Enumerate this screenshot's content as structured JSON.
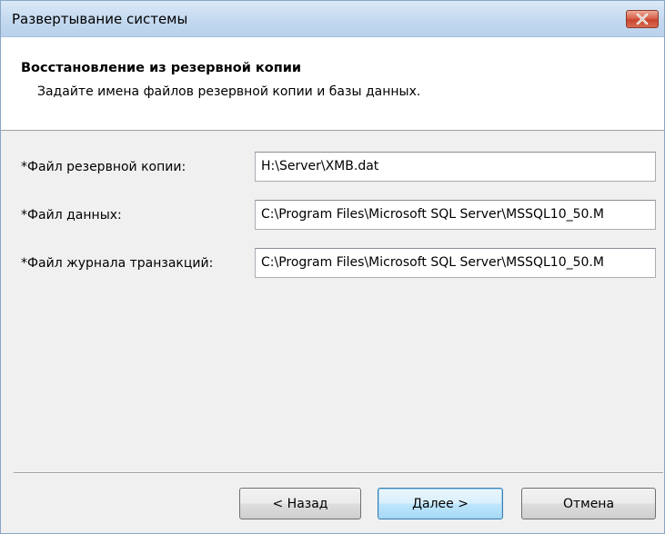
{
  "window": {
    "title": "Развертывание системы"
  },
  "header": {
    "title": "Восстановление из резервной копии",
    "subtitle": "Задайте имена файлов резервной копии и базы данных."
  },
  "fields": [
    {
      "label": "*Файл резервной копии:",
      "value": "H:\\Server\\XMB.dat"
    },
    {
      "label": "*Файл данных:",
      "value": "C:\\Program Files\\Microsoft SQL Server\\MSSQL10_50.M"
    },
    {
      "label": "*Файл журнала транзакций:",
      "value": "C:\\Program Files\\Microsoft SQL Server\\MSSQL10_50.M"
    }
  ],
  "buttons": {
    "back": "< Назад",
    "next": "Далее >",
    "cancel": "Отмена"
  },
  "icons": {
    "close": "close-icon"
  },
  "colors": {
    "close_button": "#c8442e",
    "default_button_border": "#3c7fb1"
  }
}
